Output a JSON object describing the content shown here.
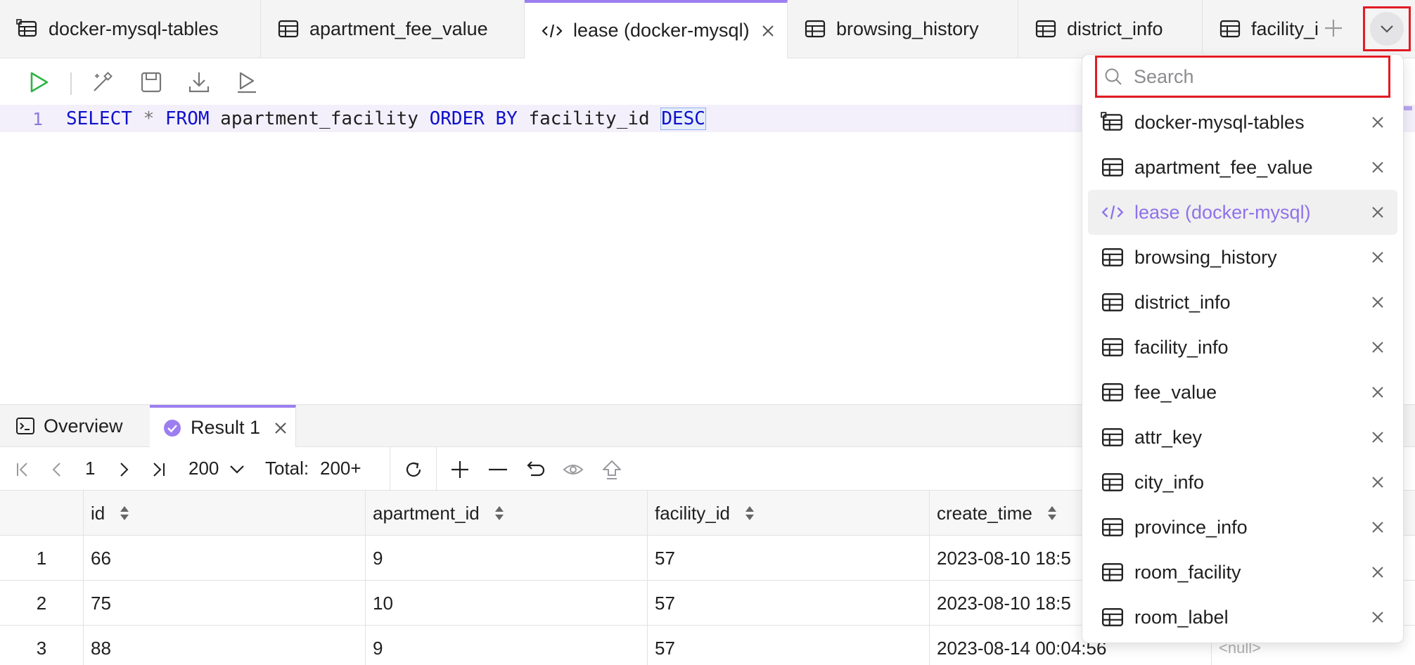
{
  "tabs": [
    {
      "label": "docker-mysql-tables",
      "icon": "database-table-icon"
    },
    {
      "label": "apartment_fee_value",
      "icon": "table-icon"
    },
    {
      "label": "lease (docker-mysql)",
      "icon": "code-icon",
      "active": true
    },
    {
      "label": "browsing_history",
      "icon": "table-icon"
    },
    {
      "label": "district_info",
      "icon": "table-icon"
    },
    {
      "label": "facility_i",
      "icon": "table-icon"
    }
  ],
  "editor": {
    "line_number": "1",
    "sql": {
      "select": "SELECT",
      "star": "*",
      "from": "FROM",
      "table": "apartment_facility",
      "order_by": "ORDER BY",
      "column": "facility_id",
      "direction": "DESC"
    }
  },
  "panel_tabs": {
    "overview": "Overview",
    "result": "Result 1"
  },
  "pagination": {
    "page": "1",
    "page_size": "200",
    "total_label": "Total:",
    "total_value": "200+"
  },
  "grid": {
    "columns": [
      "id",
      "apartment_id",
      "facility_id",
      "create_time"
    ],
    "rows": [
      {
        "num": "1",
        "id": "66",
        "apartment_id": "9",
        "facility_id": "57",
        "create_time": "2023-08-10 18:5"
      },
      {
        "num": "2",
        "id": "75",
        "apartment_id": "10",
        "facility_id": "57",
        "create_time": "2023-08-10 18:5"
      },
      {
        "num": "3",
        "id": "88",
        "apartment_id": "9",
        "facility_id": "57",
        "create_time": "2023-08-14 00:04:56",
        "extra": "<null>"
      }
    ]
  },
  "dropdown": {
    "search_placeholder": "Search",
    "items": [
      {
        "label": "docker-mysql-tables",
        "icon": "database-table-icon"
      },
      {
        "label": "apartment_fee_value",
        "icon": "table-icon"
      },
      {
        "label": "lease (docker-mysql)",
        "icon": "code-icon",
        "active": true
      },
      {
        "label": "browsing_history",
        "icon": "table-icon"
      },
      {
        "label": "district_info",
        "icon": "table-icon"
      },
      {
        "label": "facility_info",
        "icon": "table-icon"
      },
      {
        "label": "fee_value",
        "icon": "table-icon"
      },
      {
        "label": "attr_key",
        "icon": "table-icon"
      },
      {
        "label": "city_info",
        "icon": "table-icon"
      },
      {
        "label": "province_info",
        "icon": "table-icon"
      },
      {
        "label": "room_facility",
        "icon": "table-icon"
      },
      {
        "label": "room_label",
        "icon": "table-icon"
      }
    ]
  },
  "colors": {
    "accent": "#9c7ef0",
    "highlight_border": "#e31b23",
    "keyword": "#1010cc",
    "run_green": "#2fb344"
  }
}
